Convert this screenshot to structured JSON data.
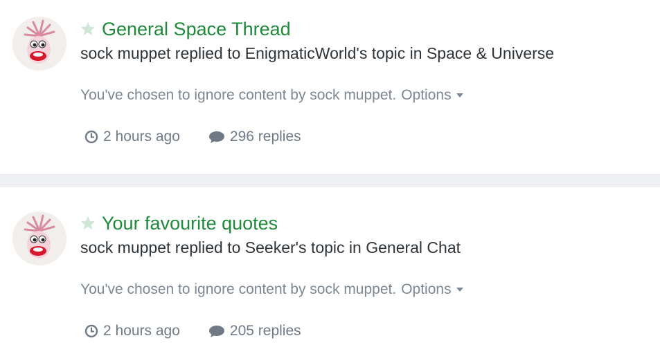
{
  "colors": {
    "title_green": "#1d8a3a",
    "muted_text": "#7c8794",
    "body_text": "#2e3338",
    "star": "#cfe6d6",
    "separator": "#eef0f3"
  },
  "items": [
    {
      "avatar_icon": "sock-muppet-avatar",
      "star_icon": "star-icon",
      "title": "General Space Thread",
      "subtitle": "sock muppet replied to EnigmaticWorld's topic in Space & Universe",
      "ignore_text": "You've chosen to ignore content by sock muppet.",
      "options_label": "Options",
      "time": "2 hours ago",
      "replies": "296 replies"
    },
    {
      "avatar_icon": "sock-muppet-avatar",
      "star_icon": "star-icon",
      "title": "Your favourite quotes",
      "subtitle": "sock muppet replied to Seeker's topic in General Chat",
      "ignore_text": "You've chosen to ignore content by sock muppet.",
      "options_label": "Options",
      "time": "2 hours ago",
      "replies": "205 replies"
    }
  ]
}
